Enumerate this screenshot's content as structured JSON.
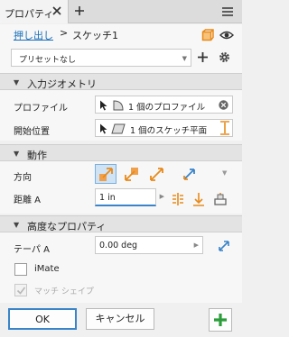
{
  "tab": {
    "label": "プロパティ"
  },
  "breadcrumb": {
    "link": "押し出し",
    "separator": ">",
    "current": "スケッチ1"
  },
  "preset": {
    "value": "プリセットなし"
  },
  "input_geometry": {
    "title": "入力ジオメトリ",
    "profile_label": "プロファイル",
    "profile_value": "1 個のプロファイル",
    "start_label": "開始位置",
    "start_value": "1 個のスケッチ平面"
  },
  "behavior": {
    "title": "動作",
    "direction_label": "方向",
    "distance_label": "距離 A",
    "distance_value": "1 in"
  },
  "advanced": {
    "title": "高度なプロパティ",
    "taper_label": "テーパ A",
    "taper_value": "0.00 deg",
    "imate_label": "iMate",
    "match_shape_label": "マッチ シェイプ"
  },
  "footer": {
    "ok_label": "OK",
    "cancel_label": "キャンセル"
  },
  "colors": {
    "accent": "#3a84c9",
    "link": "#1a6fb9",
    "orange": "#e88a1a",
    "apply_green": "#2a9d3a"
  }
}
